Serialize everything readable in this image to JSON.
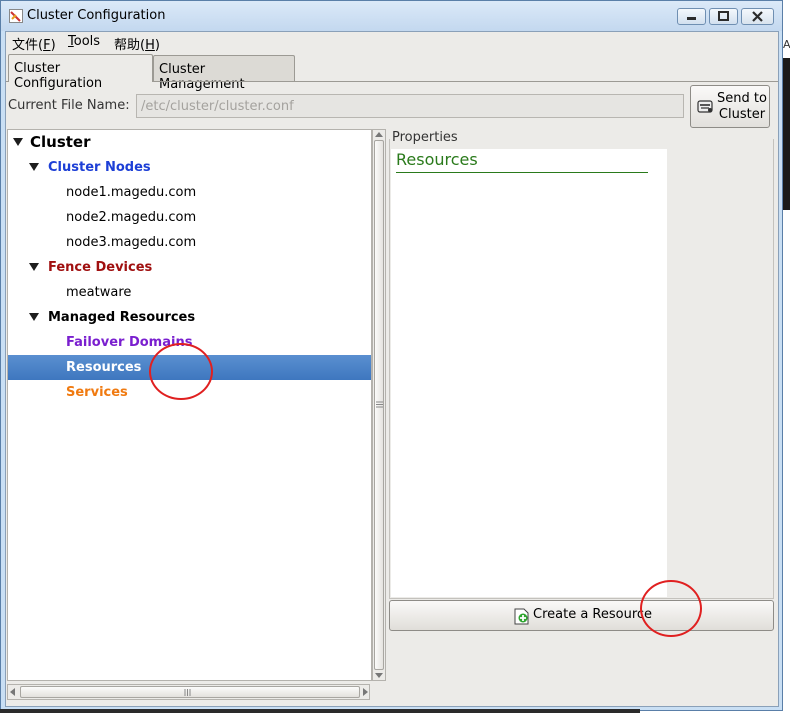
{
  "window": {
    "title": "Cluster Configuration",
    "controls": [
      "minimize-icon",
      "maximize-icon",
      "close-icon"
    ]
  },
  "menubar": {
    "items": [
      {
        "text": "文件(",
        "accel": "F",
        "tail": ")"
      },
      {
        "text": "",
        "accel": "T",
        "tail": "ools"
      },
      {
        "text": "帮助(",
        "accel": "H",
        "tail": ")"
      }
    ]
  },
  "tabs": [
    {
      "label": "Cluster Configuration",
      "active": true
    },
    {
      "label": "Cluster Management",
      "active": false
    }
  ],
  "file": {
    "label": "Current File Name:",
    "value": "/etc/cluster/cluster.conf"
  },
  "send_button": {
    "line1": "Send to",
    "line2": "Cluster"
  },
  "tree": {
    "root": "Cluster",
    "cluster_nodes": {
      "label": "Cluster Nodes",
      "color": "#1d3fd6",
      "children": [
        "node1.magedu.com",
        "node2.magedu.com",
        "node3.magedu.com"
      ]
    },
    "fence_devices": {
      "label": "Fence Devices",
      "color": "#a01010",
      "children": [
        "meatware"
      ]
    },
    "managed_resources": {
      "label": "Managed Resources",
      "failover_domains": {
        "label": "Failover Domains",
        "color": "#7a1fcf"
      },
      "resources": {
        "label": "Resources",
        "selected": true
      },
      "services": {
        "label": "Services",
        "color": "#f07a10"
      }
    }
  },
  "properties": {
    "label": "Properties",
    "heading": "Resources",
    "heading_color": "#2a7a1b"
  },
  "create_button": {
    "label": "Create a Resource"
  },
  "desktop_fragment": {
    "char": "A"
  }
}
